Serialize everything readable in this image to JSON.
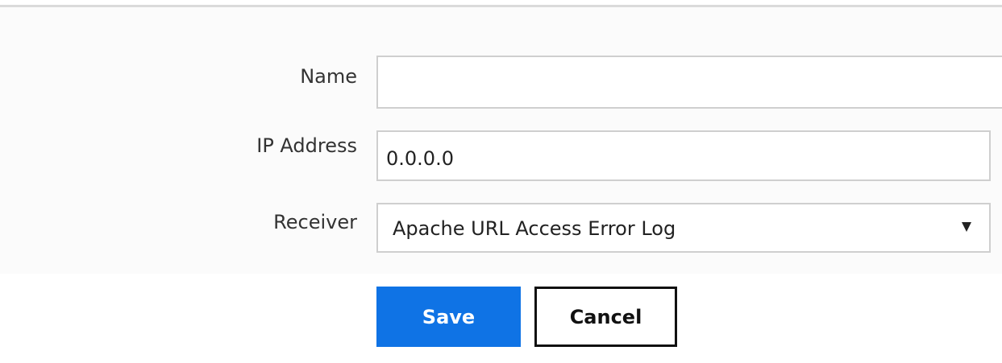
{
  "form": {
    "name": {
      "label": "Name",
      "value": ""
    },
    "ip_address": {
      "label": "IP Address",
      "value": "0.0.0.0"
    },
    "receiver": {
      "label": "Receiver",
      "selected": "Apache URL Access Error Log"
    }
  },
  "actions": {
    "save_label": "Save",
    "cancel_label": "Cancel"
  },
  "colors": {
    "primary": "#0f73e5",
    "border": "#cfcfcf",
    "divider": "#dadada"
  },
  "icons": {
    "select_arrow": "chevron-down-icon"
  }
}
